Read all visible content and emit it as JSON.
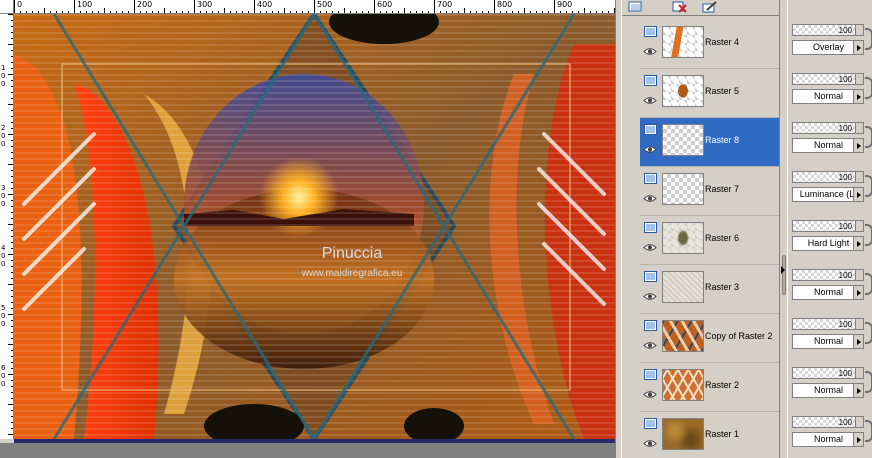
{
  "canvas": {
    "ruler_h_labels": [
      "0",
      "100",
      "200",
      "300",
      "400",
      "500",
      "600",
      "700",
      "800",
      "900"
    ],
    "ruler_v_labels": [
      "1\n0\n0",
      "2\n0\n0",
      "3\n0\n0",
      "4\n0\n0",
      "5\n0\n0",
      "6\n0\n0"
    ],
    "watermark_title": "Pinuccia",
    "watermark_url": "www.maidiregrafica.eu"
  },
  "layers": [
    {
      "name": "Raster 4",
      "opacity": "100",
      "blend": "Overlay",
      "selected": false,
      "thumb": "raster4"
    },
    {
      "name": "Raster 5",
      "opacity": "100",
      "blend": "Normal",
      "selected": false,
      "thumb": "raster5"
    },
    {
      "name": "Raster 8",
      "opacity": "100",
      "blend": "Normal",
      "selected": true,
      "thumb": "empty"
    },
    {
      "name": "Raster 7",
      "opacity": "100",
      "blend": "Luminance (L)",
      "selected": false,
      "thumb": "empty"
    },
    {
      "name": "Raster 6",
      "opacity": "100",
      "blend": "Hard Light",
      "selected": false,
      "thumb": "raster6"
    },
    {
      "name": "Raster 3",
      "opacity": "100",
      "blend": "Normal",
      "selected": false,
      "thumb": "raster3"
    },
    {
      "name": "Copy of Raster 2",
      "opacity": "100",
      "blend": "Normal",
      "selected": false,
      "thumb": "copyraster2"
    },
    {
      "name": "Raster 2",
      "opacity": "100",
      "blend": "Normal",
      "selected": false,
      "thumb": "raster2"
    },
    {
      "name": "Raster 1",
      "opacity": "100",
      "blend": "Normal",
      "selected": false,
      "thumb": "raster1"
    }
  ],
  "icons": {
    "toolbar": [
      "new-layer-icon",
      "delete-layer-icon",
      "layer-properties-icon"
    ],
    "row": [
      "raster-layer-icon",
      "eye-visibility-icon"
    ]
  },
  "colors": {
    "selection": "#316ac5",
    "panel": "#d4d0c8"
  }
}
